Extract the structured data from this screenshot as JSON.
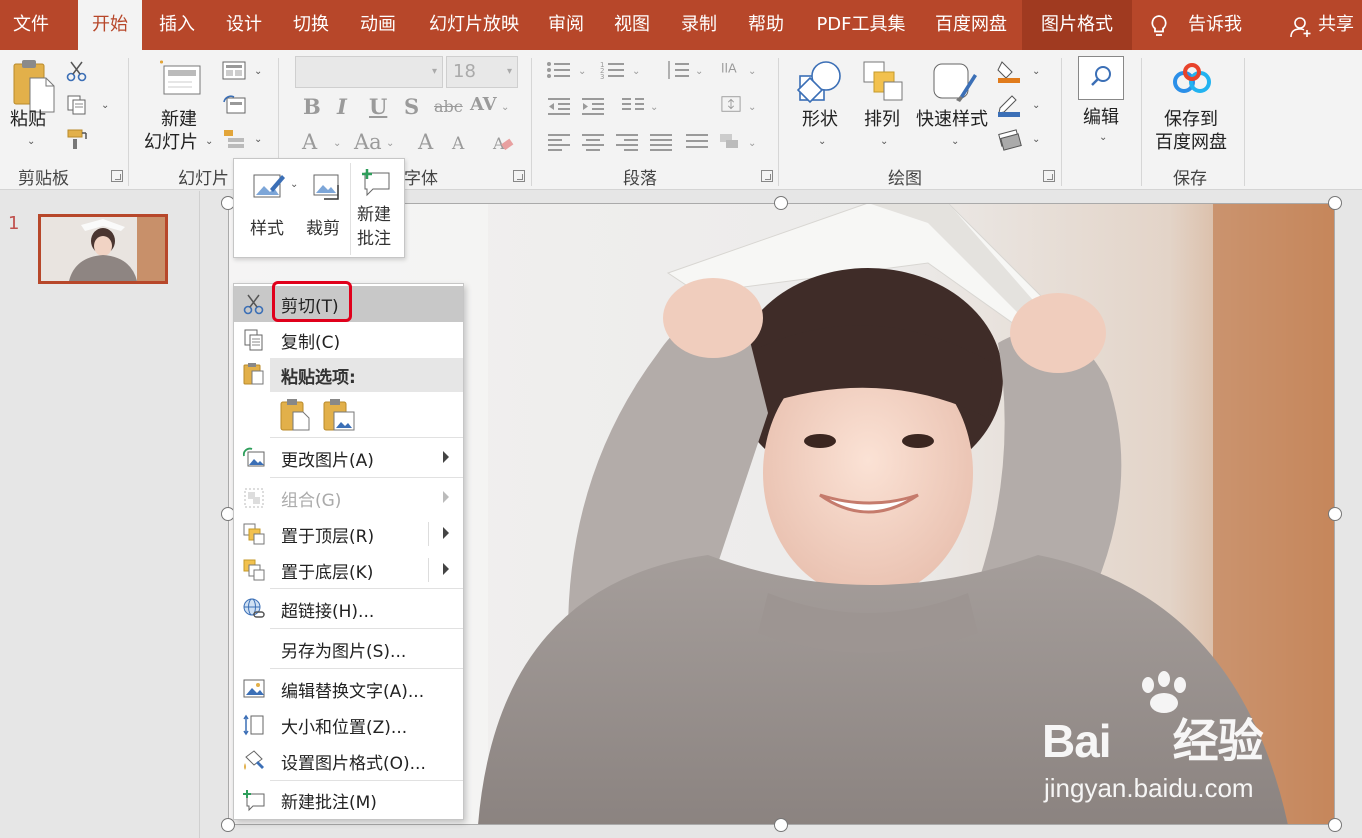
{
  "tabs": [
    {
      "label": "文件",
      "active": false
    },
    {
      "label": "开始",
      "active": true
    },
    {
      "label": "插入",
      "active": false
    },
    {
      "label": "设计",
      "active": false
    },
    {
      "label": "切换",
      "active": false
    },
    {
      "label": "动画",
      "active": false
    },
    {
      "label": "幻灯片放映",
      "active": false
    },
    {
      "label": "审阅",
      "active": false
    },
    {
      "label": "视图",
      "active": false
    },
    {
      "label": "录制",
      "active": false
    },
    {
      "label": "帮助",
      "active": false
    },
    {
      "label": "PDF工具集",
      "active": false
    },
    {
      "label": "百度网盘",
      "active": false
    },
    {
      "label": "图片格式",
      "active": false
    }
  ],
  "tell_me": "告诉我",
  "share": "共享",
  "ribbon": {
    "clipboard": {
      "paste": "粘贴",
      "group": "剪贴板"
    },
    "slides": {
      "new_slide_line1": "新建",
      "new_slide_line2": "幻灯片",
      "group": "幻灯片"
    },
    "font": {
      "font_size": "18",
      "group": "字体"
    },
    "paragraph": {
      "group": "段落"
    },
    "drawing": {
      "shapes": "形状",
      "arrange": "排列",
      "quick_styles": "快速样式",
      "group": "绘图"
    },
    "editing": {
      "edit": "编辑"
    },
    "save": {
      "line1": "保存到",
      "line2": "百度网盘",
      "group": "保存"
    }
  },
  "thumbnails": {
    "slide_number": "1"
  },
  "mini_toolbar": {
    "style": "样式",
    "crop": "裁剪",
    "new_comment_line1": "新建",
    "new_comment_line2": "批注"
  },
  "context_menu": {
    "cut": "剪切(T)",
    "copy": "复制(C)",
    "paste_options": "粘贴选项:",
    "change_picture": "更改图片(A)",
    "group": "组合(G)",
    "bring_to_front": "置于顶层(R)",
    "send_to_back": "置于底层(K)",
    "hyperlink": "超链接(H)...",
    "save_as_picture": "另存为图片(S)...",
    "edit_alt_text": "编辑替换文字(A)...",
    "size_position": "大小和位置(Z)...",
    "format_picture": "设置图片格式(O)...",
    "new_comment": "新建批注(M)"
  },
  "watermark": {
    "brand": "Bai",
    "brand_suffix": "经验",
    "url": "jingyan.baidu.com"
  },
  "colors": {
    "accent": "#b7472a",
    "highlight": "#e0001b"
  }
}
